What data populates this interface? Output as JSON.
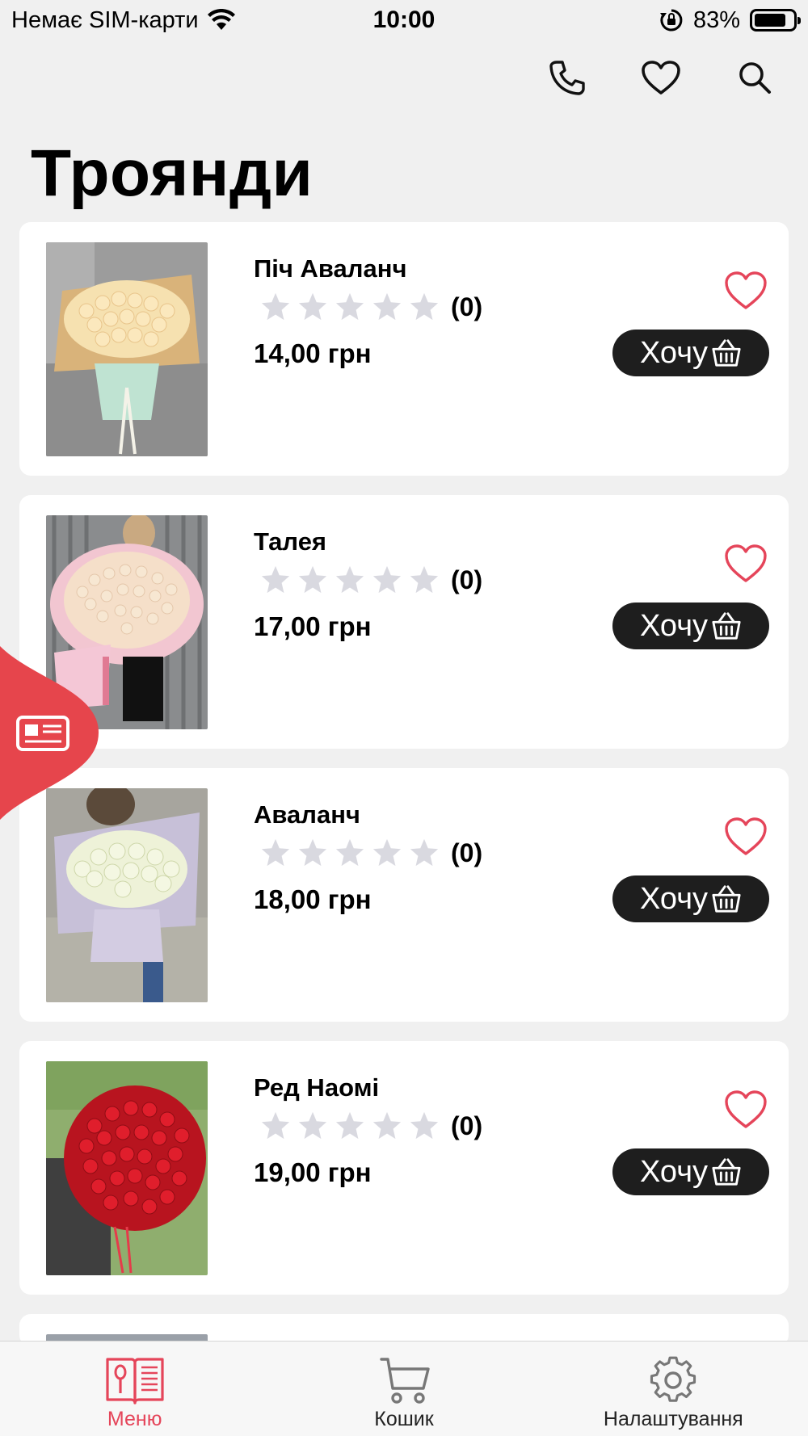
{
  "status_bar": {
    "carrier": "Немає SIM-карти",
    "time": "10:00",
    "battery": "83%"
  },
  "page": {
    "title": "Троянди"
  },
  "colors": {
    "accent": "#e5455a",
    "button_bg": "#1e1e1e",
    "star_empty": "#d9d9e0",
    "background": "#f0f0f0"
  },
  "products": [
    {
      "name": "Піч Аваланч",
      "rating_count": "(0)",
      "price": "14,00 грн",
      "button_label": "Хочу"
    },
    {
      "name": "Талея",
      "rating_count": "(0)",
      "price": "17,00 грн",
      "button_label": "Хочу"
    },
    {
      "name": "Аваланч",
      "rating_count": "(0)",
      "price": "18,00 грн",
      "button_label": "Хочу"
    },
    {
      "name": "Ред Наомі",
      "rating_count": "(0)",
      "price": "19,00 грн",
      "button_label": "Хочу"
    }
  ],
  "tab_bar": {
    "tabs": [
      {
        "label": "Меню",
        "icon": "menu-book-icon",
        "active": true
      },
      {
        "label": "Кошик",
        "icon": "cart-icon",
        "active": false
      },
      {
        "label": "Налаштування",
        "icon": "gear-icon",
        "active": false
      }
    ]
  }
}
